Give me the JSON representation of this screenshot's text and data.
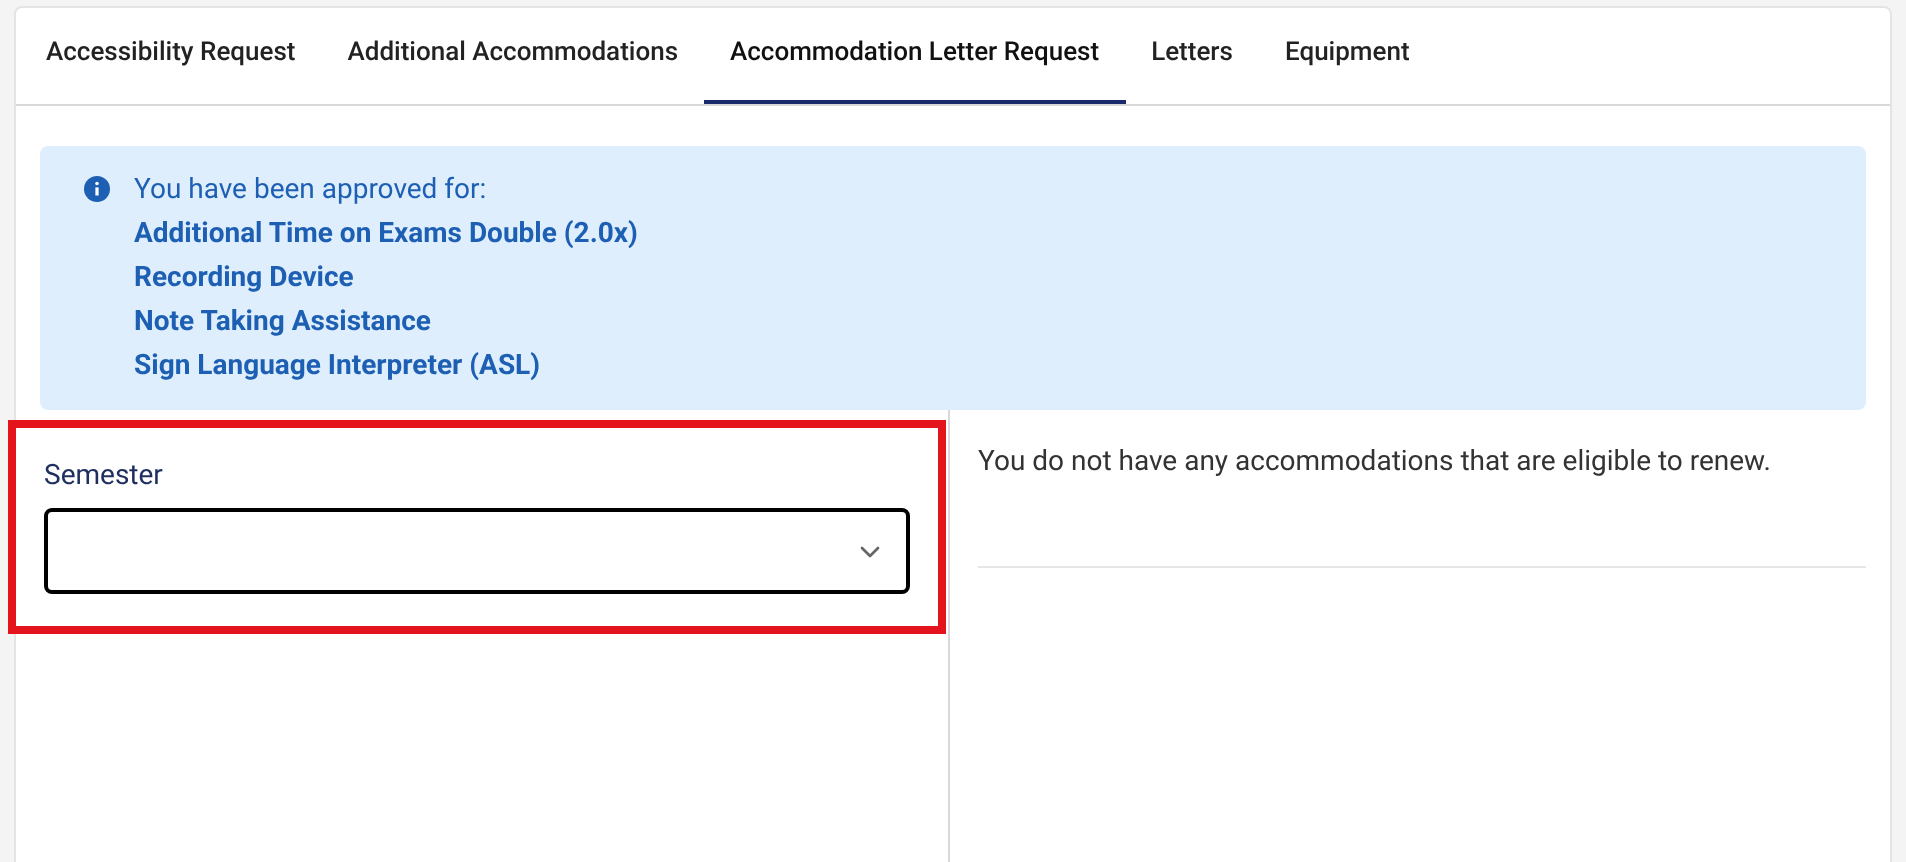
{
  "tabs": [
    {
      "label": "Accessibility Request",
      "selected": false
    },
    {
      "label": "Additional Accommodations",
      "selected": false
    },
    {
      "label": "Accommodation Letter Request",
      "selected": true
    },
    {
      "label": "Letters",
      "selected": false
    },
    {
      "label": "Equipment",
      "selected": false
    }
  ],
  "notice": {
    "heading": "You have been approved for:",
    "items": [
      "Additional Time on Exams Double (2.0x)",
      "Recording Device",
      "Note Taking Assistance",
      "Sign Language Interpreter (ASL)"
    ]
  },
  "semester_field": {
    "label": "Semester",
    "highlighted": true
  },
  "renewal_message": "You do not have any accommodations that are eligible to renew."
}
